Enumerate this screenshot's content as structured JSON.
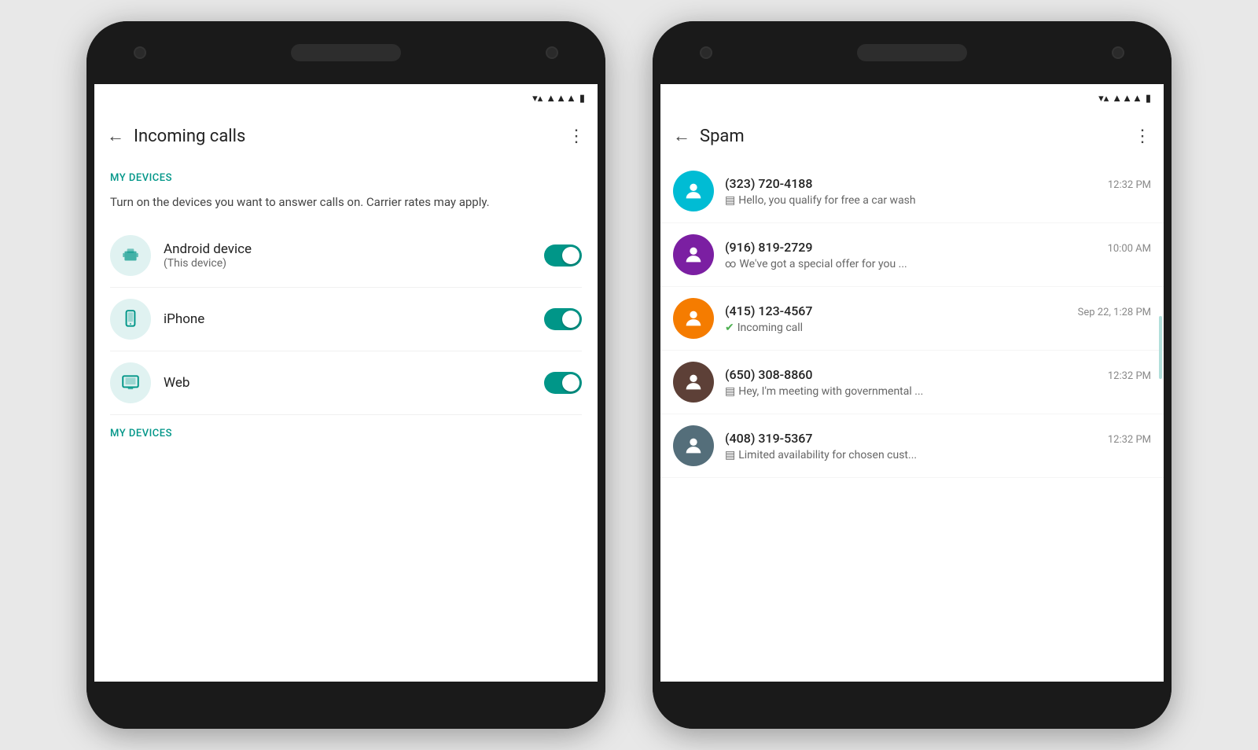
{
  "colors": {
    "teal": "#009688",
    "teal_light": "#e0f2f1",
    "bg": "#e8e8e8",
    "phone_body": "#1a1a1a",
    "avatar_teal": "#00BCD4",
    "avatar_purple": "#7B1FA2",
    "avatar_orange": "#F57C00",
    "avatar_brown": "#5D4037",
    "avatar_blue_grey": "#546E7A"
  },
  "phone1": {
    "app_bar": {
      "title": "Incoming calls",
      "back_label": "←",
      "more_label": "⋮"
    },
    "section1": {
      "header": "MY DEVICES",
      "description": "Turn on the devices you want to answer calls on. Carrier rates may apply."
    },
    "devices": [
      {
        "name": "Android device",
        "sub": "(This device)",
        "icon": "android",
        "enabled": true
      },
      {
        "name": "iPhone",
        "sub": "",
        "icon": "phone",
        "enabled": true
      },
      {
        "name": "Web",
        "sub": "",
        "icon": "desktop",
        "enabled": true
      }
    ],
    "section2": {
      "header": "MY DEVICES"
    }
  },
  "phone2": {
    "app_bar": {
      "title": "Spam",
      "back_label": "←",
      "more_label": "⋮"
    },
    "contacts": [
      {
        "number": "(323) 720-4188",
        "time": "12:32 PM",
        "preview": "Hello, you qualify for free a car wash",
        "preview_icon": "msg",
        "avatar_color": "#00BCD4"
      },
      {
        "number": "(916) 819-2729",
        "time": "10:00 AM",
        "preview": "We've got a special offer for you ...",
        "preview_icon": "voicemail",
        "avatar_color": "#7B1FA2"
      },
      {
        "number": "(415) 123-4567",
        "time": "Sep 22, 1:28 PM",
        "preview": "Incoming call",
        "preview_icon": "call",
        "avatar_color": "#F57C00"
      },
      {
        "number": "(650) 308-8860",
        "time": "12:32 PM",
        "preview": "Hey, I'm meeting with governmental ...",
        "preview_icon": "msg",
        "avatar_color": "#5D4037"
      },
      {
        "number": "(408) 319-5367",
        "time": "12:32 PM",
        "preview": "Limited availability for chosen cust...",
        "preview_icon": "msg",
        "avatar_color": "#546E7A"
      }
    ]
  }
}
